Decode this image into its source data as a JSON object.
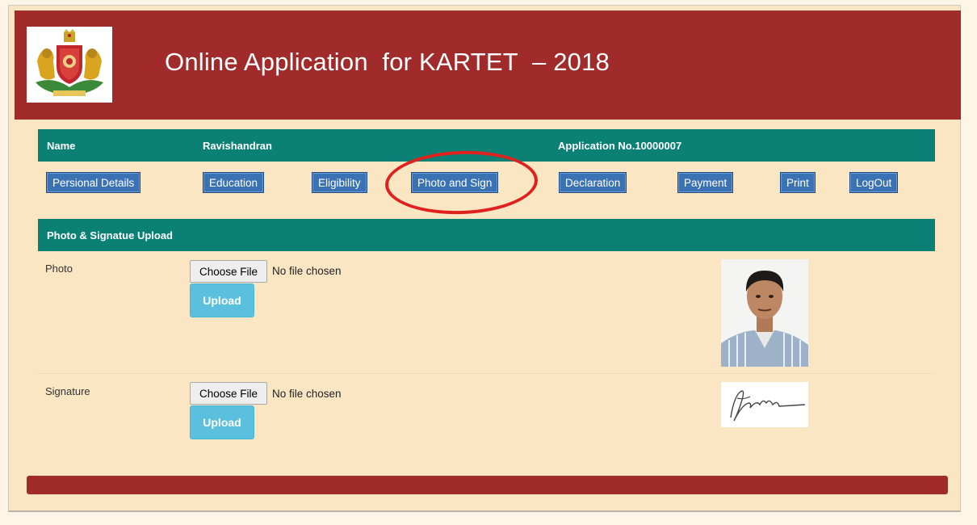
{
  "header": {
    "title": "Online Application  for KARTET  – 2018",
    "logo_name": "karnataka-emblem"
  },
  "applicant": {
    "name_label": "Name",
    "name_value": "Ravishandran",
    "application_label": "Application No.",
    "application_number": "10000007"
  },
  "nav": [
    {
      "label": "Persional Details"
    },
    {
      "label": "Education"
    },
    {
      "label": "Eligibility"
    },
    {
      "label": "Photo and Sign"
    },
    {
      "label": "Declaration"
    },
    {
      "label": "Payment"
    },
    {
      "label": "Print"
    },
    {
      "label": "LogOut"
    }
  ],
  "section": {
    "title": "Photo & Signatue Upload"
  },
  "photo_row": {
    "label": "Photo",
    "choose_label": "Choose File",
    "status": "No file chosen",
    "upload_label": "Upload"
  },
  "signature_row": {
    "label": "Signature",
    "choose_label": "Choose File",
    "status": "No file chosen",
    "upload_label": "Upload"
  },
  "colors": {
    "header": "#a12b2b",
    "teal_bar": "#0b8075",
    "nav_button": "#3a72b4",
    "upload_button": "#5bc0de",
    "highlight_ring": "#e0201c",
    "page_background": "#fbe6c4"
  }
}
